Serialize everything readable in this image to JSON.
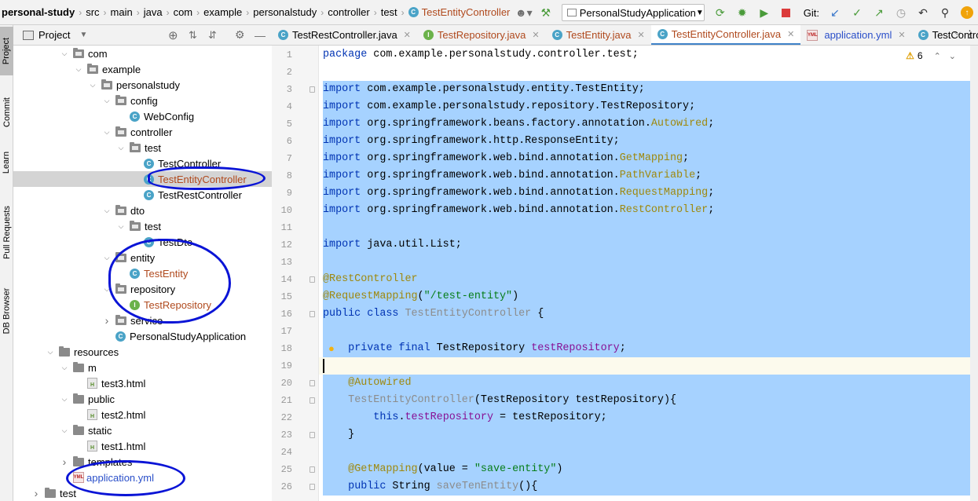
{
  "breadcrumb": [
    "personal-study",
    "src",
    "main",
    "java",
    "com",
    "example",
    "personalstudy",
    "controller",
    "test",
    "TestEntityController"
  ],
  "toolbar": {
    "run_config": "PersonalStudyApplication",
    "git_label": "Git:"
  },
  "left_strip": [
    "Project",
    "Commit",
    "Learn",
    "Pull Requests",
    "DB Browser"
  ],
  "project_panel": {
    "title": "Project"
  },
  "tree": [
    {
      "label": "com",
      "kind": "package",
      "depth": 4,
      "open": true
    },
    {
      "label": "example",
      "kind": "package",
      "depth": 5,
      "open": true
    },
    {
      "label": "personalstudy",
      "kind": "package",
      "depth": 6,
      "open": true
    },
    {
      "label": "config",
      "kind": "package",
      "depth": 7,
      "open": true
    },
    {
      "label": "WebConfig",
      "kind": "class",
      "depth": 8
    },
    {
      "label": "controller",
      "kind": "package",
      "depth": 7,
      "open": true
    },
    {
      "label": "test",
      "kind": "package",
      "depth": 8,
      "open": true
    },
    {
      "label": "TestController",
      "kind": "class",
      "depth": 9
    },
    {
      "label": "TestEntityController",
      "kind": "class",
      "depth": 9,
      "selected": true
    },
    {
      "label": "TestRestController",
      "kind": "class",
      "depth": 9
    },
    {
      "label": "dto",
      "kind": "package",
      "depth": 7,
      "open": true
    },
    {
      "label": "test",
      "kind": "package",
      "depth": 8,
      "open": true
    },
    {
      "label": "TestDto",
      "kind": "class",
      "depth": 9
    },
    {
      "label": "entity",
      "kind": "package",
      "depth": 7,
      "open": true
    },
    {
      "label": "TestEntity",
      "kind": "class",
      "depth": 8,
      "changed": true
    },
    {
      "label": "repository",
      "kind": "package",
      "depth": 7,
      "open": true
    },
    {
      "label": "TestRepository",
      "kind": "interface",
      "depth": 8,
      "changed": true
    },
    {
      "label": "service",
      "kind": "package",
      "depth": 7
    },
    {
      "label": "PersonalStudyApplication",
      "kind": "class",
      "depth": 7
    },
    {
      "label": "resources",
      "kind": "folder",
      "depth": 3,
      "open": true
    },
    {
      "label": "m",
      "kind": "folder",
      "depth": 4,
      "open": true
    },
    {
      "label": "test3.html",
      "kind": "html",
      "depth": 5
    },
    {
      "label": "public",
      "kind": "folder",
      "depth": 4,
      "open": true
    },
    {
      "label": "test2.html",
      "kind": "html",
      "depth": 5
    },
    {
      "label": "static",
      "kind": "folder",
      "depth": 4,
      "open": true
    },
    {
      "label": "test1.html",
      "kind": "html",
      "depth": 5
    },
    {
      "label": "templates",
      "kind": "folder",
      "depth": 4
    },
    {
      "label": "application.yml",
      "kind": "yml",
      "depth": 4,
      "changed": true
    },
    {
      "label": "test",
      "kind": "folder",
      "depth": 2
    }
  ],
  "tabs": [
    {
      "label": "TestRestController.java",
      "kind": "class"
    },
    {
      "label": "TestRepository.java",
      "kind": "interface",
      "changed": true
    },
    {
      "label": "TestEntity.java",
      "kind": "class",
      "changed": true
    },
    {
      "label": "TestEntityController.java",
      "kind": "class",
      "changed": true,
      "active": true
    },
    {
      "label": "application.yml",
      "kind": "yml",
      "changed": true
    },
    {
      "label": "TestControll",
      "kind": "class"
    }
  ],
  "editor": {
    "warning_count": "6",
    "lines": [
      {
        "n": "1",
        "html": "<span class='kw'>package</span> com.example.personalstudy.controller.test;"
      },
      {
        "n": "2",
        "html": ""
      },
      {
        "n": "3",
        "html": "<span class='kw'>import</span> com.example.personalstudy.entity.TestEntity;"
      },
      {
        "n": "4",
        "html": "<span class='kw'>import</span> com.example.personalstudy.repository.TestRepository;"
      },
      {
        "n": "5",
        "html": "<span class='kw'>import</span> org.springframework.beans.factory.annotation.<span class='ann'>Autowired</span>;"
      },
      {
        "n": "6",
        "html": "<span class='kw'>import</span> org.springframework.http.ResponseEntity;"
      },
      {
        "n": "7",
        "html": "<span class='kw'>import</span> org.springframework.web.bind.annotation.<span class='ann'>GetMapping</span>;"
      },
      {
        "n": "8",
        "html": "<span class='kw'>import</span> org.springframework.web.bind.annotation.<span class='ann'>PathVariable</span>;"
      },
      {
        "n": "9",
        "html": "<span class='kw'>import</span> org.springframework.web.bind.annotation.<span class='ann'>RequestMapping</span>;"
      },
      {
        "n": "10",
        "html": "<span class='kw'>import</span> org.springframework.web.bind.annotation.<span class='ann'>RestController</span>;"
      },
      {
        "n": "11",
        "html": ""
      },
      {
        "n": "12",
        "html": "<span class='kw'>import</span> java.util.List;"
      },
      {
        "n": "13",
        "html": ""
      },
      {
        "n": "14",
        "html": "<span class='ann'>@RestController</span>"
      },
      {
        "n": "15",
        "html": "<span class='ann'>@RequestMapping</span>(<span class='str'>\"/test-entity\"</span>)"
      },
      {
        "n": "16",
        "html": "<span class='kw'>public class</span> <span class='gry'>TestEntityController</span> {"
      },
      {
        "n": "17",
        "html": ""
      },
      {
        "n": "18",
        "html": "    <span class='kw'>private final</span> TestRepository <span class='fld'>testRepository</span>;"
      },
      {
        "n": "19",
        "html": ""
      },
      {
        "n": "20",
        "html": "    <span class='ann'>@Autowired</span>"
      },
      {
        "n": "21",
        "html": "    <span class='gry'>TestEntityController</span>(TestRepository testRepository){"
      },
      {
        "n": "22",
        "html": "        <span class='kw'>this</span>.<span class='fld'>testRepository</span> = testRepository;"
      },
      {
        "n": "23",
        "html": "    }"
      },
      {
        "n": "24",
        "html": ""
      },
      {
        "n": "25",
        "html": "    <span class='ann'>@GetMapping</span>(value = <span class='str'>\"save-entity\"</span>)"
      },
      {
        "n": "26",
        "html": "    <span class='kw'>public</span> String <span class='gry'>saveTenEntity</span>(){"
      }
    ]
  }
}
